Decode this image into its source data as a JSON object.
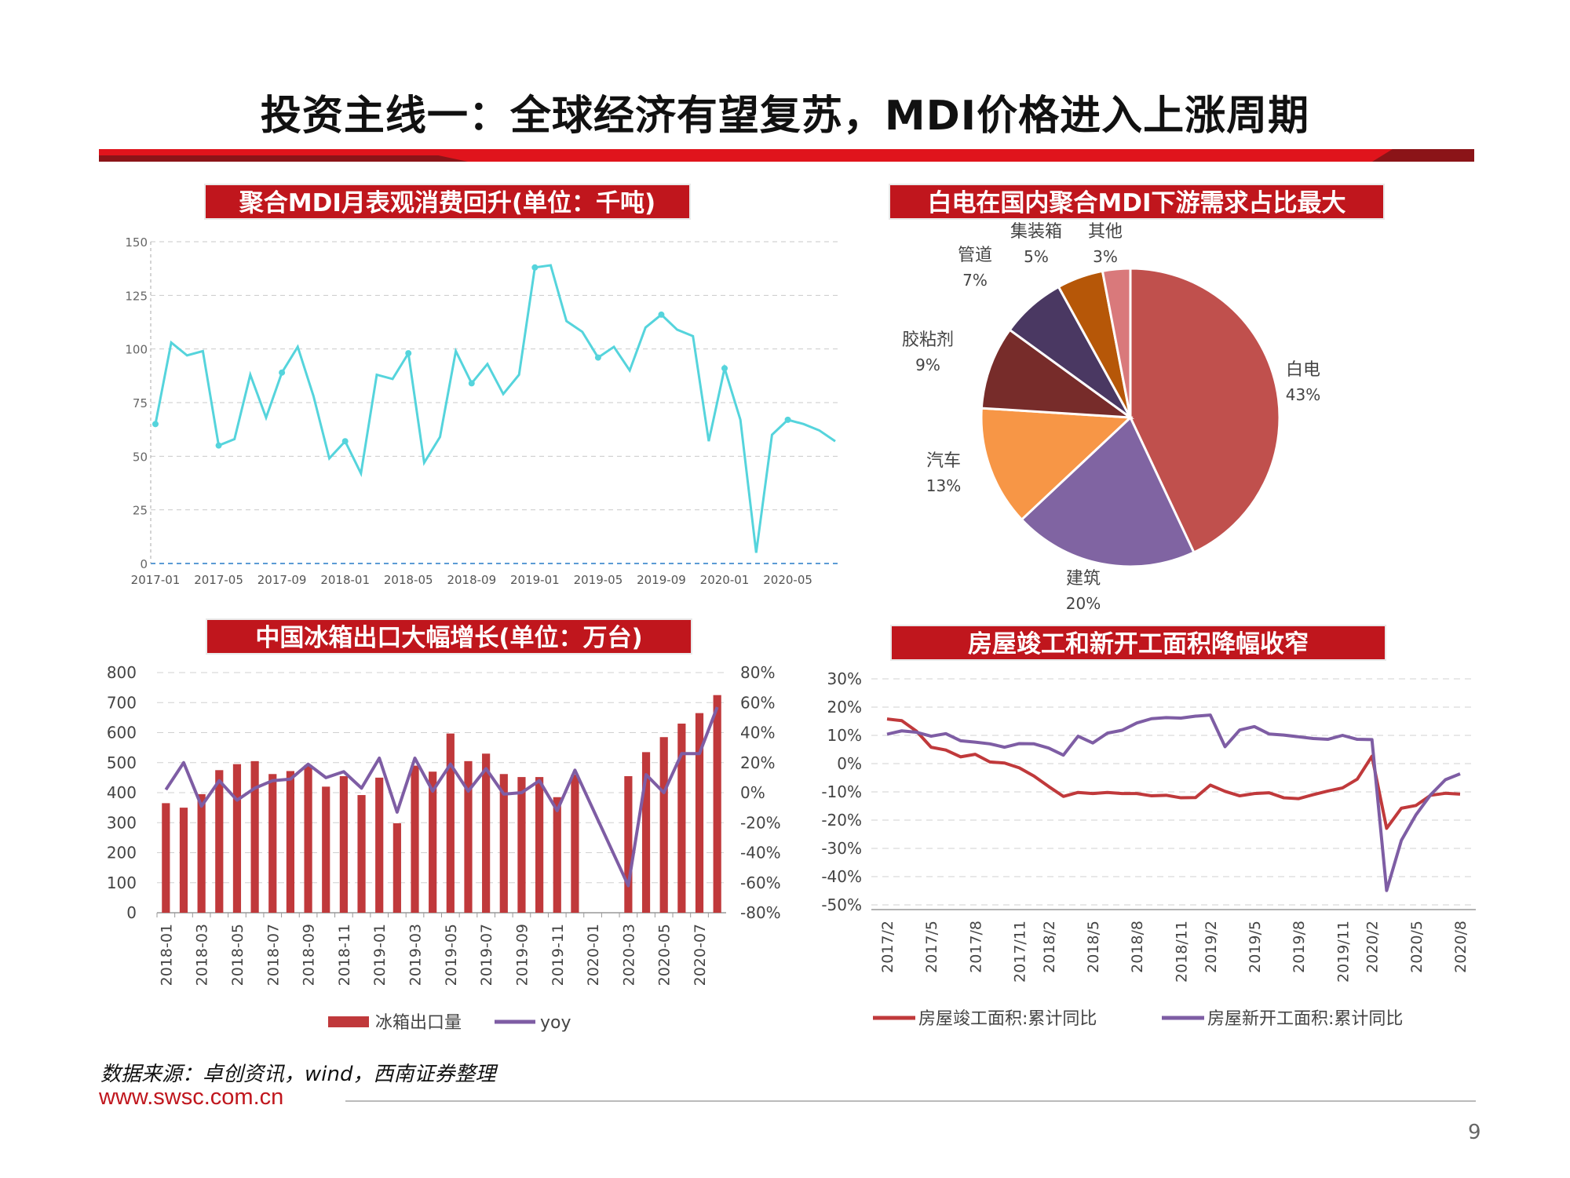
{
  "page": {
    "title": "投资主线一：全球经济有望复苏，MDI价格进入上涨周期",
    "source": "数据来源：卓创资讯，wind，西南证券整理",
    "url": "www.swsc.com.cn",
    "page_number": "9"
  },
  "colors": {
    "banner": "#e0141c",
    "banner_dark": "#8b1418",
    "panel_title_bg": "#c0161d",
    "line_teal": "#55d4dc",
    "bar_red": "#c0393b",
    "yoy_purple": "#7e5da4",
    "pie": [
      "#c0504d",
      "#8064a2",
      "#f79646",
      "#772c2a",
      "#4a3862",
      "#b65708",
      "#d9797b"
    ]
  },
  "chart_data": [
    {
      "id": "mdi",
      "type": "line",
      "title": "聚合MDI月表观消费回升(单位：千吨)",
      "xlabel": "",
      "ylabel": "",
      "ylim": [
        0,
        150
      ],
      "yticks": [
        "0",
        "25",
        "50",
        "75",
        "100",
        "125",
        "150"
      ],
      "xtick_labels": [
        "2017-01",
        "2017-05",
        "2017-09",
        "2018-01",
        "2018-05",
        "2018-09",
        "2019-01",
        "2019-05",
        "2019-09",
        "2020-01",
        "2020-05"
      ],
      "values": [
        65,
        103,
        97,
        99,
        55,
        58,
        88,
        68,
        89,
        101,
        78,
        49,
        57,
        42,
        88,
        86,
        98,
        47,
        59,
        99,
        84,
        93,
        79,
        88,
        138,
        139,
        113,
        108,
        96,
        101,
        90,
        110,
        116,
        109,
        106,
        57,
        91,
        67,
        5,
        60,
        67,
        65,
        62,
        57
      ],
      "markers": [
        0,
        4,
        8,
        12,
        16,
        20,
        24,
        28,
        32,
        36,
        40
      ],
      "grid": true
    },
    {
      "id": "pie",
      "type": "pie",
      "title": "白电在国内聚合MDI下游需求占比最大",
      "slices": [
        {
          "label": "白电",
          "value": 43,
          "pct": "43%"
        },
        {
          "label": "建筑",
          "value": 20,
          "pct": "20%"
        },
        {
          "label": "汽车",
          "value": 13,
          "pct": "13%"
        },
        {
          "label": "胶粘剂",
          "value": 9,
          "pct": "9%"
        },
        {
          "label": "管道",
          "value": 7,
          "pct": "7%"
        },
        {
          "label": "集装箱",
          "value": 5,
          "pct": "5%"
        },
        {
          "label": "其他",
          "value": 3,
          "pct": "3%"
        }
      ]
    },
    {
      "id": "fridge",
      "type": "bar",
      "title": "中国冰箱出口大幅增长(单位：万台)",
      "ylim": [
        0,
        800
      ],
      "y2lim": [
        -80,
        80
      ],
      "yticks": [
        "0",
        "100",
        "200",
        "300",
        "400",
        "500",
        "600",
        "700",
        "800"
      ],
      "y2ticks": [
        "-80%",
        "-60%",
        "-40%",
        "-20%",
        "0%",
        "20%",
        "40%",
        "60%",
        "80%"
      ],
      "categories": [
        "2018-01",
        "2018-02",
        "2018-03",
        "2018-04",
        "2018-05",
        "2018-06",
        "2018-07",
        "2018-08",
        "2018-09",
        "2018-10",
        "2018-11",
        "2018-12",
        "2019-01",
        "2019-02",
        "2019-03",
        "2019-04",
        "2019-05",
        "2019-06",
        "2019-07",
        "2019-08",
        "2019-09",
        "2019-10",
        "2019-11",
        "2019-12",
        "2020-01",
        "2020-02",
        "2020-03",
        "2020-04",
        "2020-05",
        "2020-06",
        "2020-07",
        "2020-08"
      ],
      "xtick_labels": [
        "2018-01",
        "2018-03",
        "2018-05",
        "2018-07",
        "2018-09",
        "2018-11",
        "2019-01",
        "2019-03",
        "2019-05",
        "2019-07",
        "2019-09",
        "2019-11",
        "2020-01",
        "2020-03",
        "2020-05",
        "2020-07"
      ],
      "series": [
        {
          "name": "冰箱出口量",
          "kind": "bar",
          "values": [
            365,
            350,
            395,
            475,
            495,
            505,
            462,
            472,
            492,
            420,
            455,
            392,
            450,
            298,
            490,
            470,
            597,
            505,
            530,
            462,
            452,
            452,
            385,
            460,
            null,
            null,
            455,
            535,
            585,
            630,
            665,
            725
          ]
        },
        {
          "name": "yoy",
          "kind": "line",
          "values": [
            2,
            20,
            -9,
            8,
            -5,
            3,
            8,
            9,
            19,
            10,
            14,
            3,
            23,
            -13,
            23,
            1,
            19,
            1,
            16,
            -1,
            0,
            8,
            -12,
            15,
            null,
            null,
            -62,
            12,
            0,
            26,
            26,
            57
          ]
        }
      ]
    },
    {
      "id": "housing",
      "type": "line",
      "title": "房屋竣工和新开工面积降幅收窄",
      "ylim": [
        -50,
        30
      ],
      "yticks": [
        "-50%",
        "-40%",
        "-30%",
        "-20%",
        "-10%",
        "0%",
        "10%",
        "20%",
        "30%"
      ],
      "categories": [
        "2017/2",
        "2017/3",
        "2017/4",
        "2017/5",
        "2017/6",
        "2017/7",
        "2017/8",
        "2017/9",
        "2017/10",
        "2017/11",
        "2017/12",
        "2018/2",
        "2018/3",
        "2018/4",
        "2018/5",
        "2018/6",
        "2018/7",
        "2018/8",
        "2018/9",
        "2018/10",
        "2018/11",
        "2018/12",
        "2019/2",
        "2019/3",
        "2019/4",
        "2019/5",
        "2019/6",
        "2019/7",
        "2019/8",
        "2019/9",
        "2019/10",
        "2019/11",
        "2019/12",
        "2020/2",
        "2020/3",
        "2020/4",
        "2020/5",
        "2020/6",
        "2020/7",
        "2020/8"
      ],
      "xtick_labels": [
        "2017/2",
        "2017/5",
        "2017/8",
        "2017/11",
        "2018/2",
        "2018/5",
        "2018/8",
        "2018/11",
        "2019/2",
        "2019/5",
        "2019/8",
        "2019/11",
        "2020/2",
        "2020/5",
        "2020/8"
      ],
      "series": [
        {
          "name": "房屋竣工面积:累计同比",
          "color": "#c0393b",
          "values": [
            15.8,
            15.2,
            11.5,
            5.8,
            4.8,
            2.4,
            3.3,
            0.6,
            0.2,
            -1.5,
            -4.4,
            -8.1,
            -11.6,
            -10.2,
            -10.6,
            -10.2,
            -10.6,
            -10.6,
            -11.4,
            -11.2,
            -12.1,
            -12.0,
            -7.6,
            -9.8,
            -11.4,
            -10.6,
            -10.3,
            -12.1,
            -12.4,
            -11.0,
            -9.7,
            -8.6,
            -5.5,
            2.6,
            -22.9,
            -15.8,
            -14.8,
            -11.2,
            -10.5,
            -10.8
          ]
        },
        {
          "name": "房屋新开工面积:累计同比",
          "color": "#7e5da4",
          "values": [
            10.4,
            11.6,
            11.1,
            9.7,
            10.6,
            8.1,
            7.6,
            7.0,
            5.8,
            7.1,
            7.0,
            5.5,
            3.0,
            9.7,
            7.3,
            10.8,
            11.8,
            14.4,
            15.9,
            16.3,
            16.1,
            16.8,
            17.2,
            6.0,
            11.9,
            13.1,
            10.5,
            10.1,
            9.5,
            8.9,
            8.6,
            10.0,
            8.6,
            8.5,
            -44.9,
            -27.2,
            -18.1,
            -11.0,
            -5.7,
            -3.6
          ]
        }
      ]
    }
  ]
}
